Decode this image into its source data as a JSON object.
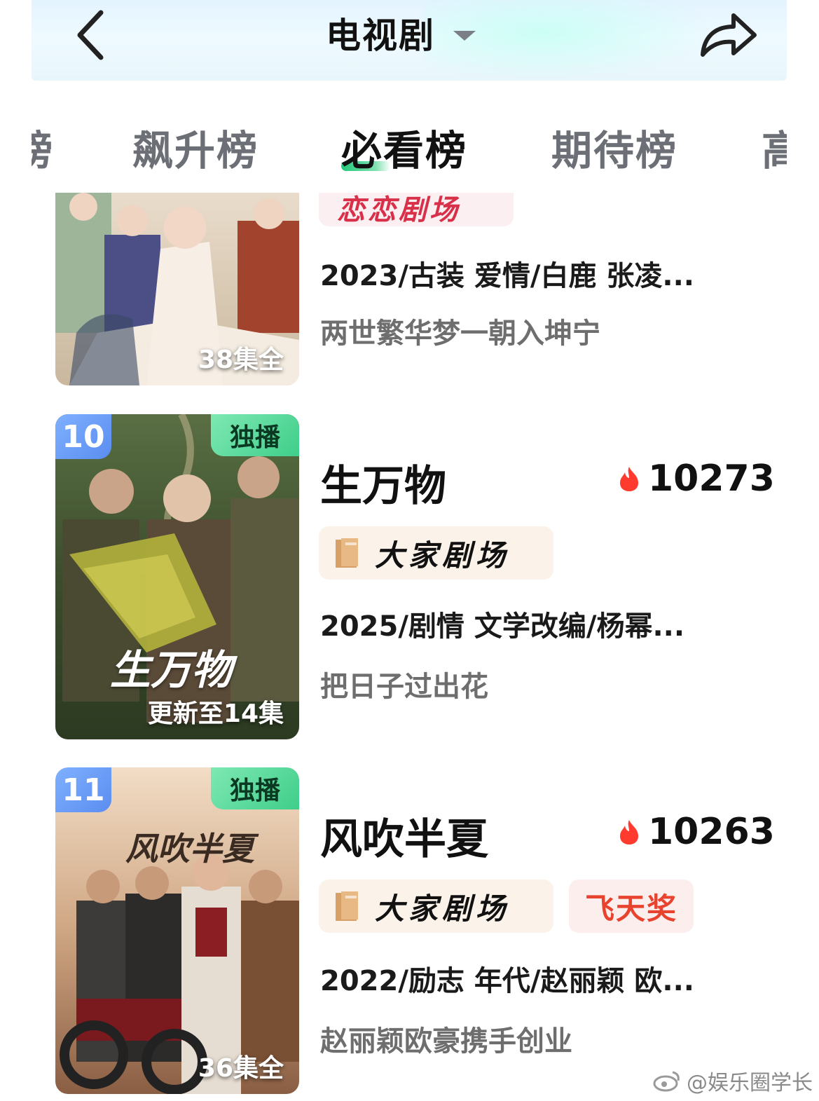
{
  "header": {
    "title": "电视剧"
  },
  "tabs": [
    {
      "label": "榜"
    },
    {
      "label": "飙升榜"
    },
    {
      "label": "必看榜"
    },
    {
      "label": "期待榜"
    },
    {
      "label": "高"
    }
  ],
  "items": [
    {
      "episodes": "38集全",
      "theater_logo": "恋恋剧场",
      "meta": "2023/古装 爱情/白鹿 张凌...",
      "desc": "两世繁华梦一朝入坤宁"
    },
    {
      "rank": "10",
      "exclusive": "独播",
      "poster_title": "生万物",
      "episodes": "更新至14集",
      "name": "生万物",
      "heat": "10273",
      "theater": "大家剧场",
      "meta": "2025/剧情 文学改编/杨幂...",
      "desc": "把日子过出花"
    },
    {
      "rank": "11",
      "exclusive": "独播",
      "poster_title": "风吹半夏",
      "episodes": "36集全",
      "name": "风吹半夏",
      "heat": "10263",
      "theater": "大家剧场",
      "award": "飞天奖",
      "meta": "2022/励志 年代/赵丽颖 欧...",
      "desc": "赵丽颖欧豪携手创业"
    }
  ],
  "watermark": "@娱乐圈学长",
  "colors": {
    "accent_green": "#2fcf86",
    "rank_blue": "#6a9cf5",
    "heat_red": "#ff3b2f",
    "award_red": "#e8432e"
  }
}
